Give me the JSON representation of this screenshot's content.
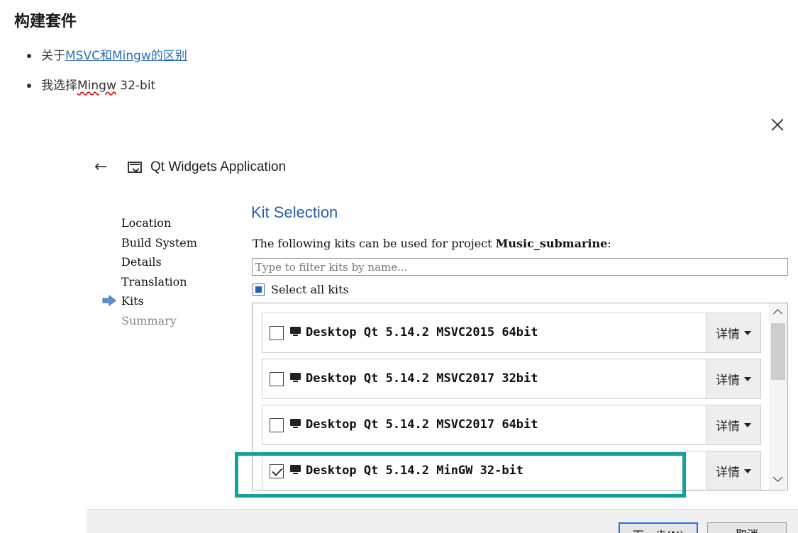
{
  "article": {
    "title": "构建套件",
    "bullets": [
      {
        "prefix": "关于",
        "link": "MSVC和Mingw的区别"
      },
      {
        "prefix": "我选择",
        "flagged": "Mingw",
        "suffix": " 32-bit"
      }
    ]
  },
  "wizard": {
    "title": "Qt Widgets Application",
    "steps": [
      "Location",
      "Build System",
      "Details",
      "Translation",
      "Kits",
      "Summary"
    ],
    "current_step": "Kits",
    "heading": "Kit Selection",
    "description_prefix": "The following kits can be used for project ",
    "project_name": "Music_submarine",
    "description_suffix": ":",
    "filter_placeholder": "Type to filter kits by name...",
    "filter_value": "",
    "select_all_label": "Select all kits",
    "select_all_state": "partial",
    "kits": [
      {
        "name": "Desktop Qt 5.14.2 MSVC2015 64bit",
        "checked": false,
        "details_label": "详情"
      },
      {
        "name": "Desktop Qt 5.14.2 MSVC2017 32bit",
        "checked": false,
        "details_label": "详情"
      },
      {
        "name": "Desktop Qt 5.14.2 MSVC2017 64bit",
        "checked": false,
        "details_label": "详情"
      },
      {
        "name": "Desktop Qt 5.14.2 MinGW 32-bit",
        "checked": true,
        "details_label": "详情"
      }
    ],
    "buttons": {
      "next": "下一步(N)",
      "cancel": "取消"
    }
  },
  "colors": {
    "heading": "#2b5fa9",
    "link": "#2a6fb8",
    "highlight": "#13a199",
    "arrow": "#5b8fd6"
  },
  "icons": {
    "close": "close-icon",
    "back": "back-arrow-icon",
    "app": "app-window-icon",
    "current_step": "current-step-arrow-icon",
    "kit": "monitor-icon"
  }
}
